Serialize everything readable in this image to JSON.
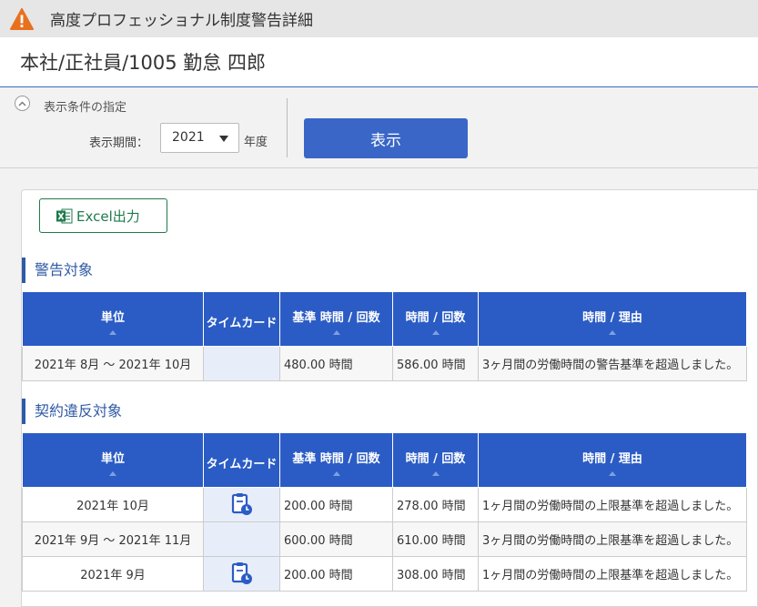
{
  "window": {
    "title": "高度プロフェッショナル制度警告詳細"
  },
  "employee": {
    "label": "本社/正社員/1005 勤怠 四郎"
  },
  "filter": {
    "heading": "表示条件の指定",
    "period_label": "表示期間：",
    "year_value": "2021",
    "year_suffix": "年度",
    "show_button": "表示"
  },
  "export": {
    "excel_label": "Excel出力"
  },
  "columns": {
    "unit": "単位",
    "timecard": "タイムカード",
    "standard": "基準 時間 / 回数",
    "actual": "時間 / 回数",
    "reason": "時間 / 理由"
  },
  "warning_section": {
    "title": "警告対象",
    "rows": [
      {
        "unit": "2021年 8月 ～ 2021年 10月",
        "has_timecard": false,
        "standard": "480.00 時間",
        "actual": "586.00 時間",
        "reason": "3ヶ月間の労働時間の警告基準を超過しました。"
      }
    ]
  },
  "violation_section": {
    "title": "契約違反対象",
    "rows": [
      {
        "unit": "2021年 10月",
        "has_timecard": true,
        "standard": "200.00 時間",
        "actual": "278.00 時間",
        "reason": "1ヶ月間の労働時間の上限基準を超過しました。"
      },
      {
        "unit": "2021年 9月 ～ 2021年 11月",
        "has_timecard": false,
        "standard": "600.00 時間",
        "actual": "610.00 時間",
        "reason": "3ヶ月間の労働時間の上限基準を超過しました。"
      },
      {
        "unit": "2021年 9月",
        "has_timecard": true,
        "standard": "200.00 時間",
        "actual": "308.00 時間",
        "reason": "1ヶ月間の労働時間の上限基準を超過しました。"
      }
    ]
  },
  "colors": {
    "accent": "#2b5cc5",
    "excel_green": "#1f7a4d",
    "warning": "#e8711f"
  },
  "icons": {
    "title": "warning-triangle-icon",
    "excel": "excel-icon",
    "timecard": "timecard-clipboard-clock-icon",
    "toggle": "chevron-up-icon"
  }
}
